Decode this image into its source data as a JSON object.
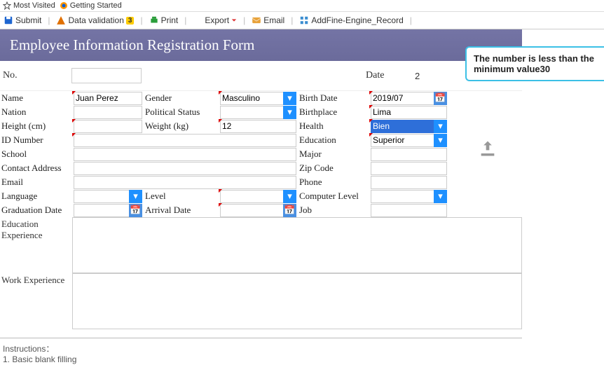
{
  "bookmarks": {
    "most_visited": "Most Visited",
    "getting_started": "Getting Started"
  },
  "toolbar": {
    "submit": "Submit",
    "data_validation": "Data validation",
    "data_validation_count": "3",
    "print": "Print",
    "export": "Export",
    "email": "Email",
    "add_engine": "AddFine-Engine_Record"
  },
  "form_title": "Employee Information Registration Form",
  "row_no": {
    "label": "No.",
    "value": ""
  },
  "row_date": {
    "label": "Date",
    "value": "2"
  },
  "fields": {
    "name": {
      "label": "Name",
      "value": "Juan Perez"
    },
    "gender": {
      "label": "Gender",
      "value": "Masculino"
    },
    "birth_date": {
      "label": "Birth Date",
      "value": "2019/07"
    },
    "nation": {
      "label": "Nation",
      "value": ""
    },
    "political": {
      "label": "Political Status",
      "value": ""
    },
    "birthplace": {
      "label": "Birthplace",
      "value": "Lima"
    },
    "height": {
      "label": "Height (cm)",
      "value": ""
    },
    "weight": {
      "label": "Weight (kg)",
      "value": "12"
    },
    "health": {
      "label": "Health",
      "value": "Bien"
    },
    "id_number": {
      "label": "ID Number",
      "value": ""
    },
    "education": {
      "label": "Education",
      "value": "Superior"
    },
    "school": {
      "label": "School",
      "value": ""
    },
    "major": {
      "label": "Major",
      "value": ""
    },
    "contact_address": {
      "label": "Contact Address",
      "value": ""
    },
    "zip_code": {
      "label": "Zip Code",
      "value": ""
    },
    "email": {
      "label": "Email",
      "value": ""
    },
    "phone": {
      "label": "Phone",
      "value": ""
    },
    "language": {
      "label": "Language",
      "value": ""
    },
    "level": {
      "label": "Level",
      "value": ""
    },
    "computer_level": {
      "label": "Computer Level",
      "value": ""
    },
    "graduation_date": {
      "label": "Graduation Date",
      "value": ""
    },
    "arrival_date": {
      "label": "Arrival Date",
      "value": ""
    },
    "job": {
      "label": "Job",
      "value": ""
    },
    "edu_exp": {
      "label": "Education Experience",
      "value": ""
    },
    "work_exp": {
      "label": "Work Experience",
      "value": ""
    }
  },
  "instructions": {
    "header": "Instructions：",
    "line1": "1. Basic blank filling"
  },
  "tooltip": "The number is less than the minimum value30"
}
